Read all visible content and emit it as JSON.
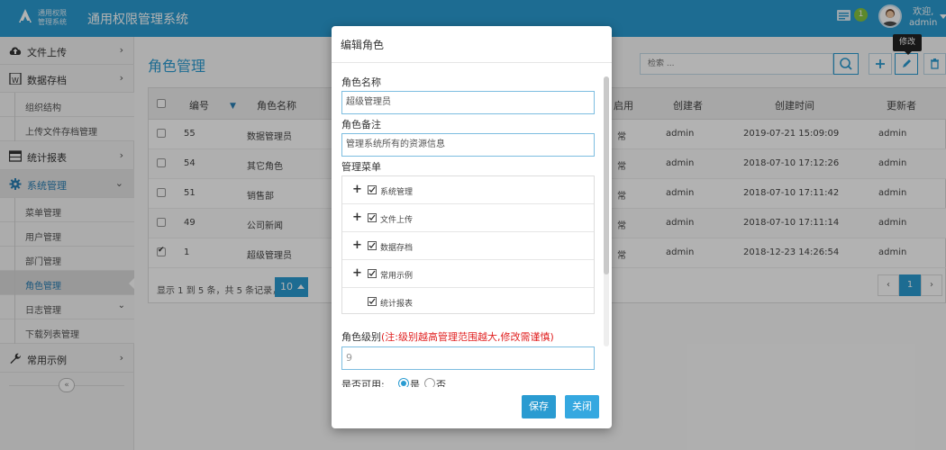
{
  "app": {
    "logo_text_line1": "通用权限",
    "logo_text_line2": "管理系统",
    "title": "通用权限管理系统",
    "notification_count": "1",
    "user_greeting": "欢迎,",
    "user_name": "admin"
  },
  "sidebar": {
    "items": [
      {
        "label": "文件上传",
        "icon": "cloud-upload-icon"
      },
      {
        "label": "数据存档",
        "icon": "archive-icon"
      },
      {
        "label": "统计报表",
        "icon": "table-report-icon"
      },
      {
        "label": "系统管理",
        "icon": "gear-icon"
      },
      {
        "label": "常用示例",
        "icon": "wrench-icon"
      }
    ],
    "sub_items": {
      "archive": [
        "组织结构",
        "上传文件存档管理"
      ],
      "system": [
        "菜单管理",
        "用户管理",
        "部门管理",
        "角色管理",
        "日志管理",
        "下载列表管理"
      ]
    },
    "collapse_glyph": "«"
  },
  "main": {
    "page_title": "角色管理",
    "search_placeholder": "检索 ...",
    "tooltip": "修改",
    "columns": [
      "编号",
      "角色名称",
      "启用",
      "创建者",
      "创建时间",
      "更新者"
    ],
    "rows": [
      {
        "id": "55",
        "name": "数据管理员",
        "status": "常",
        "creator": "admin",
        "created": "2019-07-21 15:09:09",
        "updater": "admin",
        "checked": false
      },
      {
        "id": "54",
        "name": "其它角色",
        "status": "常",
        "creator": "admin",
        "created": "2018-07-10 17:12:26",
        "updater": "admin",
        "checked": false
      },
      {
        "id": "51",
        "name": "销售部",
        "status": "常",
        "creator": "admin",
        "created": "2018-07-10 17:11:42",
        "updater": "admin",
        "checked": false
      },
      {
        "id": "49",
        "name": "公司新闻",
        "status": "常",
        "creator": "admin",
        "created": "2018-07-10 17:11:14",
        "updater": "admin",
        "checked": false
      },
      {
        "id": "1",
        "name": "超级管理员",
        "status": "常",
        "creator": "admin",
        "created": "2018-12-23 14:26:54",
        "updater": "admin",
        "checked": true
      }
    ],
    "footer_info": "显示 1 到 5 条，共 5 条记录，",
    "page_size": "10",
    "pager": [
      "‹",
      "1",
      "›"
    ]
  },
  "modal": {
    "title": "编辑角色",
    "name_label": "角色名称",
    "name_value": "超级管理员",
    "remark_label": "角色备注",
    "remark_value": "管理系统所有的资源信息",
    "menu_label": "管理菜单",
    "menu_tree": [
      {
        "label": "系统管理",
        "expandable": true
      },
      {
        "label": "文件上传",
        "expandable": true
      },
      {
        "label": "数据存档",
        "expandable": true
      },
      {
        "label": "常用示例",
        "expandable": true
      },
      {
        "label": "统计报表",
        "expandable": false
      }
    ],
    "level_label": "角色级别",
    "level_warning": "(注:级别越高管理范围越大,修改需谨慎)",
    "level_value": "9",
    "enabled_label": "是否可用:",
    "enabled_yes": "是",
    "enabled_no": "否",
    "save_label": "保存",
    "close_label": "关闭"
  },
  "colors": {
    "accent": "#2a9bd1",
    "warning": "#e02020"
  }
}
